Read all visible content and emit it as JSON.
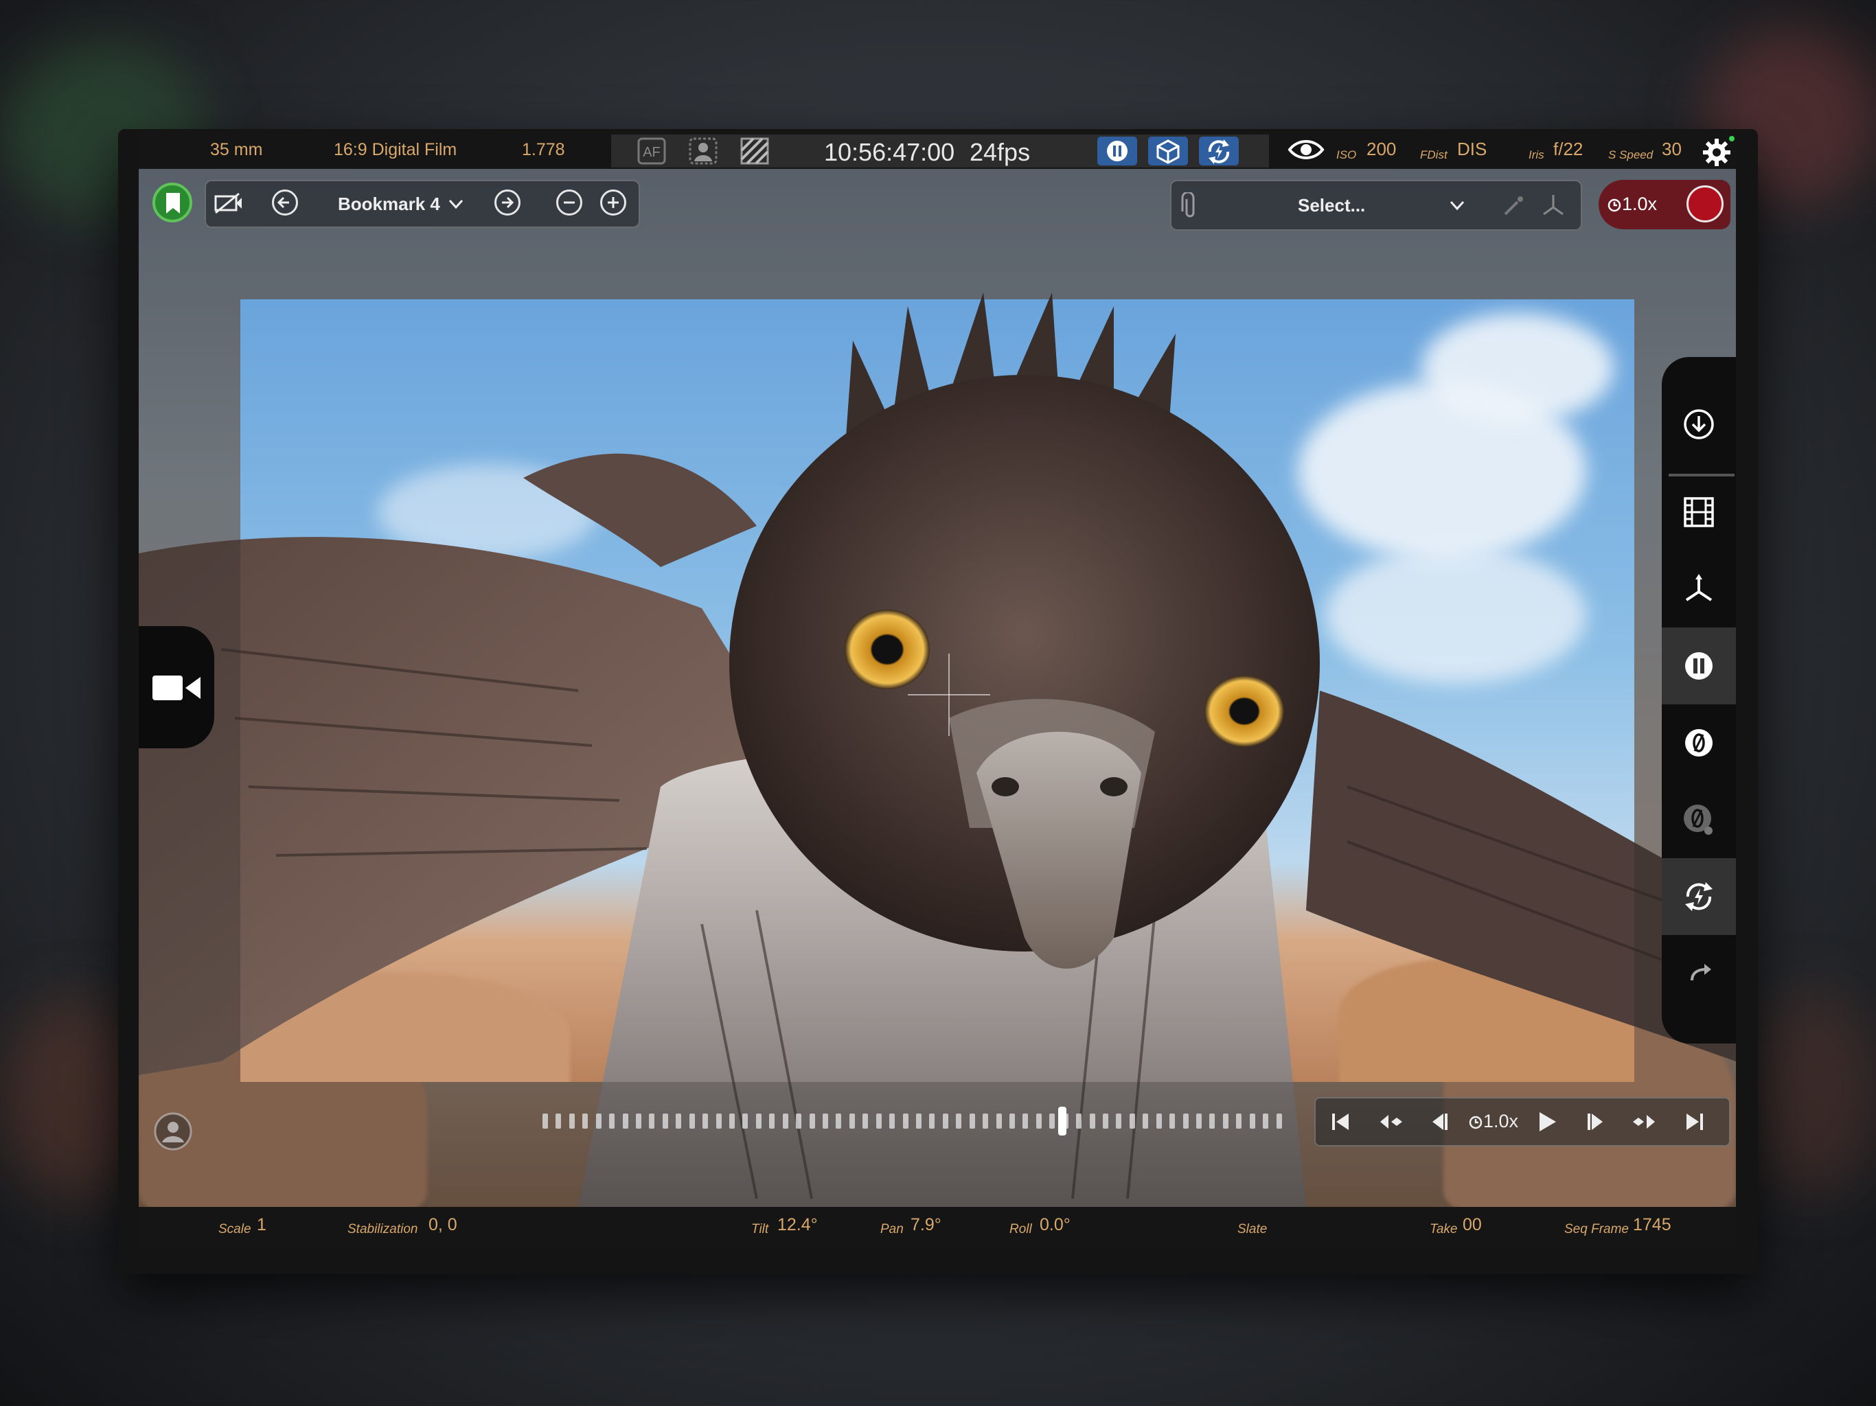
{
  "status_bar": {
    "focal_length": "35 mm",
    "format": "16:9 Digital Film",
    "aspect_ratio": "1.778",
    "af_label": "AF",
    "timecode": "10:56:47:00",
    "fps": "24fps",
    "iso_label": "ISO",
    "iso_value": "200",
    "fdist_label": "FDist",
    "fdist_value": "DIS",
    "iris_label": "Iris",
    "iris_value": "f/22",
    "shutter_label": "S Speed",
    "shutter_value": "30"
  },
  "bookmark_toolbar": {
    "current": "Bookmark 4"
  },
  "selector_toolbar": {
    "select_placeholder": "Select..."
  },
  "record": {
    "speed": "1.0x"
  },
  "transport": {
    "speed": "1.0x"
  },
  "timeline": {
    "playhead_fraction": 0.69
  },
  "info_bar": {
    "scale_label": "Scale",
    "scale_value": "1",
    "stabilization_label": "Stabilization",
    "stabilization_value": "0, 0",
    "tilt_label": "Tilt",
    "tilt_value": "12.4°",
    "pan_label": "Pan",
    "pan_value": "7.9°",
    "roll_label": "Roll",
    "roll_value": "0.0°",
    "slate_label": "Slate",
    "take_label": "Take",
    "take_value": "00",
    "seqframe_label": "Seq Frame",
    "seqframe_value": "1745"
  },
  "colors": {
    "accent_amber": "#d9a86a",
    "bookmark_green": "#3da63a",
    "record_red": "#b0101e",
    "tray_blue": "#3a6fb0"
  }
}
